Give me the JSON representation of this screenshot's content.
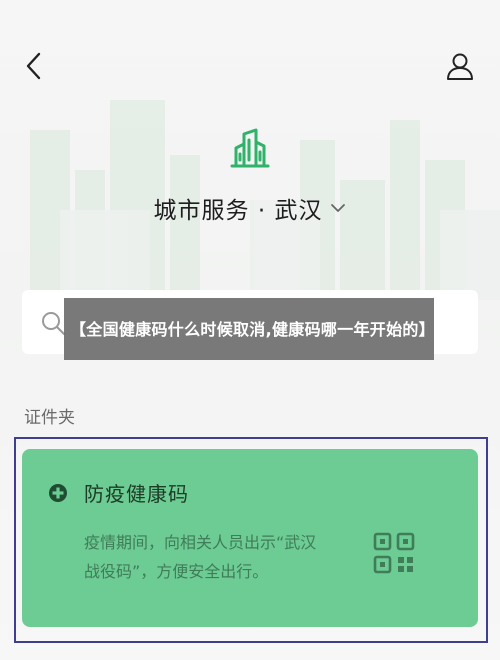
{
  "header": {
    "back_icon": "chevron-left-icon",
    "profile_icon": "user-icon",
    "city_logo_icon": "city-buildings-icon",
    "service_title": "城市服务 · 武汉",
    "dropdown_icon": "chevron-down-icon"
  },
  "search": {
    "icon": "search-icon"
  },
  "overlay": {
    "text": "【全国健康码什么时候取消,健康码哪一年开始的】"
  },
  "wallet": {
    "section_label": "证件夹",
    "card": {
      "title": "防疫健康码",
      "description": "疫情期间，向相关人员出示“武汉战役码”，方便安全出行。",
      "plus_icon": "plus-circle-icon",
      "qr_icon": "qr-code-icon"
    }
  },
  "colors": {
    "brand_green": "#2fb26a",
    "card_green": "#6dcc93",
    "frame_border": "#3f3f8f"
  }
}
